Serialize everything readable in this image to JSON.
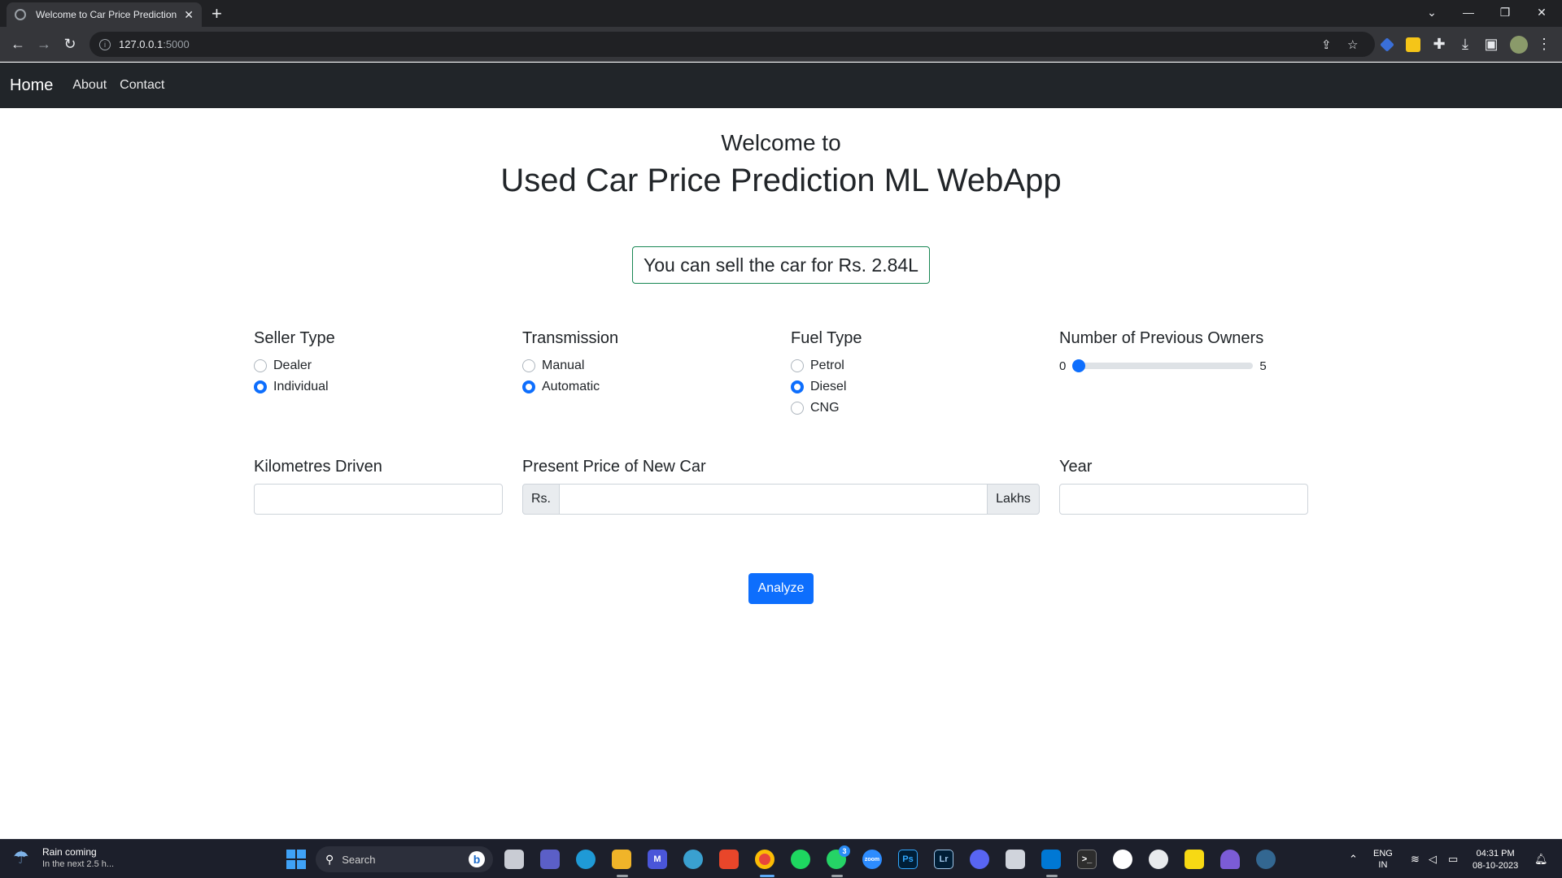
{
  "browser": {
    "tab_title": "Welcome to Car Price Prediction",
    "url_host": "127.0.0.1",
    "url_port": ":5000"
  },
  "site_nav": {
    "brand": "Home",
    "links": [
      "About",
      "Contact"
    ]
  },
  "header": {
    "welcome": "Welcome to",
    "title": "Used Car Price Prediction ML WebApp"
  },
  "result": "You can sell the car for Rs. 2.84L",
  "form": {
    "seller_type": {
      "label": "Seller Type",
      "options": [
        "Dealer",
        "Individual"
      ],
      "selected": "Individual"
    },
    "transmission": {
      "label": "Transmission",
      "options": [
        "Manual",
        "Automatic"
      ],
      "selected": "Automatic"
    },
    "fuel_type": {
      "label": "Fuel Type",
      "options": [
        "Petrol",
        "Diesel",
        "CNG"
      ],
      "selected": "Diesel"
    },
    "owners": {
      "label": "Number of Previous Owners",
      "min": "0",
      "max": "5",
      "value": 0
    },
    "kms": {
      "label": "Kilometres Driven",
      "value": ""
    },
    "present_price": {
      "label": "Present Price of New Car",
      "prefix": "Rs.",
      "suffix": "Lakhs",
      "value": ""
    },
    "year": {
      "label": "Year",
      "value": ""
    },
    "submit_label": "Analyze"
  },
  "taskbar": {
    "weather_line1": "Rain coming",
    "weather_line2": "In the next 2.5 h...",
    "search_label": "Search",
    "whatsapp_badge": "3",
    "lang_line1": "ENG",
    "lang_line2": "IN",
    "time": "04:31 PM",
    "date": "08-10-2023"
  },
  "colors": {
    "accent": "#0d6efd",
    "success_border": "#198754",
    "navbar": "#212529"
  }
}
